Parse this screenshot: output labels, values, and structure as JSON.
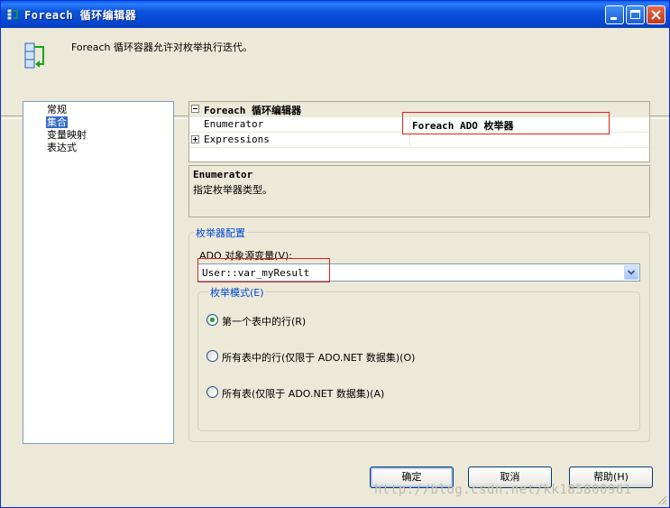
{
  "window": {
    "title": "Foreach 循环编辑器",
    "header_text": "Foreach 循环容器允许对枚举执行迭代。"
  },
  "nav": {
    "items": [
      {
        "label": "常规",
        "selected": false
      },
      {
        "label": "集合",
        "selected": true
      },
      {
        "label": "变量映射",
        "selected": false
      },
      {
        "label": "表达式",
        "selected": false
      }
    ]
  },
  "property_grid": {
    "category": "Foreach 循环编辑器",
    "rows": [
      {
        "name": "Enumerator",
        "value": "Foreach ADO 枚举器"
      },
      {
        "name": "Expressions",
        "value": ""
      }
    ]
  },
  "description": {
    "title": "Enumerator",
    "text": "指定枚举器类型。"
  },
  "enumerator_config": {
    "group_label": "枚举器配置",
    "source_label": "ADO 对象源变量(V):",
    "source_value": "User::var_myResult",
    "mode_group_label": "枚举模式(E)",
    "modes": [
      {
        "label": "第一个表中的行(R)",
        "checked": true
      },
      {
        "label": "所有表中的行(仅限于 ADO.NET 数据集)(O)",
        "checked": false
      },
      {
        "label": "所有表(仅限于 ADO.NET 数据集)(A)",
        "checked": false
      }
    ]
  },
  "buttons": {
    "ok": "确定",
    "cancel": "取消",
    "help": "帮助(H)"
  },
  "watermark": "http://blog.csdn.net/kk185800961",
  "colors": {
    "titlebar": "#0a53dc",
    "selection": "#316ac5",
    "group_label": "#0046d5",
    "highlight_border": "#e02020"
  }
}
